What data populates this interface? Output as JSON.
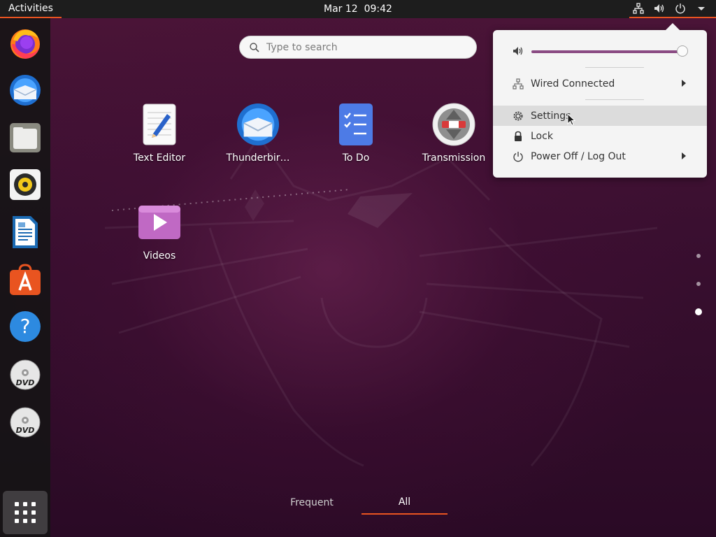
{
  "topbar": {
    "activities": "Activities",
    "date": "Mar 12",
    "time": "09:42",
    "accent_color": "#e95420",
    "tray_icons": [
      "network-icon",
      "volume-icon",
      "power-icon",
      "caret-down-icon"
    ]
  },
  "dock": {
    "items": [
      {
        "name": "Firefox",
        "icon": "firefox-icon"
      },
      {
        "name": "Thunderbird",
        "icon": "thunderbird-icon"
      },
      {
        "name": "Files",
        "icon": "files-icon"
      },
      {
        "name": "Rhythmbox",
        "icon": "rhythmbox-icon"
      },
      {
        "name": "LibreOffice Writer",
        "icon": "writer-icon"
      },
      {
        "name": "Ubuntu Software",
        "icon": "software-icon"
      },
      {
        "name": "Help",
        "icon": "help-icon"
      },
      {
        "name": "DVD",
        "icon": "dvd-icon"
      },
      {
        "name": "DVD",
        "icon": "dvd-icon"
      }
    ],
    "show_apps_icon": "apps-grid-icon"
  },
  "search": {
    "placeholder": "Type to search"
  },
  "apps": [
    {
      "label": "Text Editor",
      "icon": "text-editor-icon"
    },
    {
      "label": "Thunderbir…",
      "icon": "thunderbird-icon"
    },
    {
      "label": "To Do",
      "icon": "todo-icon"
    },
    {
      "label": "Transmission",
      "icon": "transmission-icon"
    },
    {
      "label": "Videos",
      "icon": "videos-icon"
    }
  ],
  "pager": {
    "pages": 3,
    "current": 3
  },
  "tabs": {
    "frequent": "Frequent",
    "all": "All",
    "active": "All"
  },
  "system_menu": {
    "volume_level": 0.98,
    "volume_accent": "#8a4b83",
    "wired": "Wired Connected",
    "settings": "Settings",
    "lock": "Lock",
    "power": "Power Off / Log Out"
  }
}
